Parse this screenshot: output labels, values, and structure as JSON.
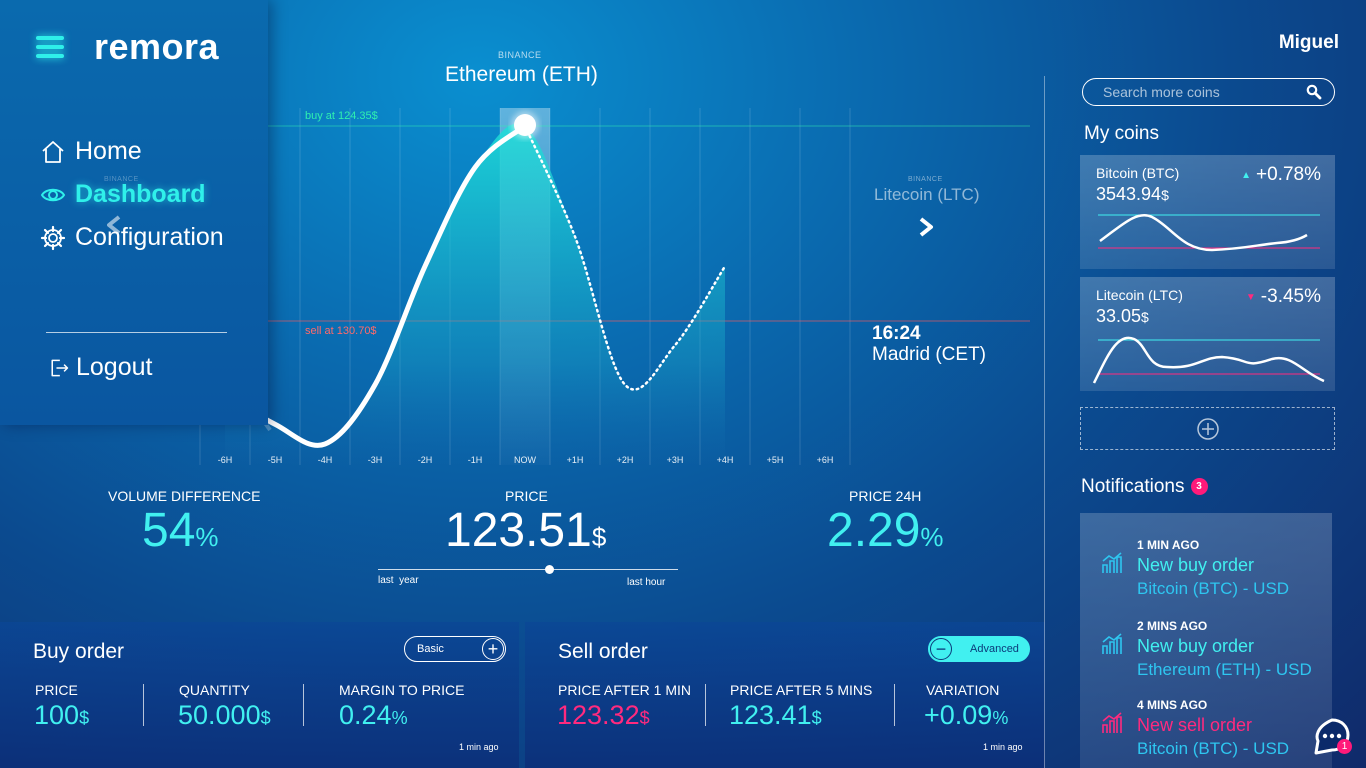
{
  "app": {
    "logo": "remora",
    "user": "Miguel"
  },
  "sidebar": {
    "items": [
      {
        "label": "Home",
        "icon": "home-icon"
      },
      {
        "label": "Dashboard",
        "icon": "eye-icon",
        "active": true
      },
      {
        "label": "Configuration",
        "icon": "gear-icon"
      }
    ],
    "logout": "Logout"
  },
  "chart": {
    "exchange": "BINANCE",
    "title": "Ethereum (ETH)",
    "next_exchange": "BINANCE",
    "next_coin": "Litecoin (LTC)",
    "prev_exchange": "BINANCE",
    "buy_line_label": "buy at 124.35$",
    "sell_line_label": "sell at 130.70$",
    "time": "16:24",
    "timezone": "Madrid (CET)",
    "colors": {
      "accent": "#41f0f0",
      "buy": "#2ff0b0",
      "sell": "#ff5a5a"
    }
  },
  "chart_data": {
    "type": "area",
    "categories": [
      "-6H",
      "-5H",
      "-4H",
      "-3H",
      "-2H",
      "-1H",
      "NOW",
      "+1H",
      "+2H",
      "+3H",
      "+4H",
      "+5H",
      "+6H"
    ],
    "series": [
      {
        "values": [
          118,
          116.5,
          115.5,
          118.5,
          124.5,
          129.5,
          131.6,
          126,
          118.5,
          120.5,
          124.5,
          null,
          null
        ]
      }
    ],
    "buy_at": 124.35,
    "sell_at": 130.7,
    "grid": true
  },
  "stats": {
    "volume_label": "VOLUME DIFFERENCE",
    "volume_value": "54",
    "volume_unit": "%",
    "price_label": "PRICE",
    "price_value": "123.51",
    "price_unit": "$",
    "price24_label": "PRICE 24H",
    "price24_value": "2.29",
    "price24_unit": "%",
    "range_left": "last  year",
    "range_right": "last hour",
    "range_position": 0.57
  },
  "buy_order": {
    "title": "Buy order",
    "mode": "Basic",
    "columns": [
      {
        "label": "PRICE",
        "value": "100",
        "unit": "$"
      },
      {
        "label": "QUANTITY",
        "value": "50.000",
        "unit": "$"
      },
      {
        "label": "MARGIN TO PRICE",
        "value": "0.24",
        "unit": "%"
      }
    ],
    "updated": "1 min ago"
  },
  "sell_order": {
    "title": "Sell order",
    "mode": "Advanced",
    "columns": [
      {
        "label": "PRICE AFTER 1 MIN",
        "value": "123.32",
        "unit": "$"
      },
      {
        "label": "PRICE AFTER 5 MINS",
        "value": "123.41",
        "unit": "$"
      },
      {
        "label": "VARIATION",
        "value": "+0.09",
        "unit": "%"
      }
    ],
    "updated": "1 min ago"
  },
  "search": {
    "placeholder": "Search more coins"
  },
  "my_coins": {
    "title": "My coins",
    "coins": [
      {
        "name": "Bitcoin (BTC)",
        "price": "3543.94",
        "unit": "$",
        "change": "+0.78%",
        "direction": "up"
      },
      {
        "name": "Litecoin (LTC)",
        "price": "33.05",
        "unit": "$",
        "change": "-3.45%",
        "direction": "down"
      }
    ]
  },
  "notifications": {
    "title": "Notifications",
    "count": "3",
    "items": [
      {
        "time": "1 MIN AGO",
        "title": "New buy order",
        "sub": "Bitcoin (BTC) - USD",
        "type": "buy"
      },
      {
        "time": "2 MINS AGO",
        "title": "New buy order",
        "sub": "Ethereum (ETH) - USD",
        "type": "buy"
      },
      {
        "time": "4 MINS AGO",
        "title": "New sell order",
        "sub": "Bitcoin (BTC) - USD",
        "type": "sell"
      }
    ]
  },
  "chat": {
    "count": "1"
  }
}
